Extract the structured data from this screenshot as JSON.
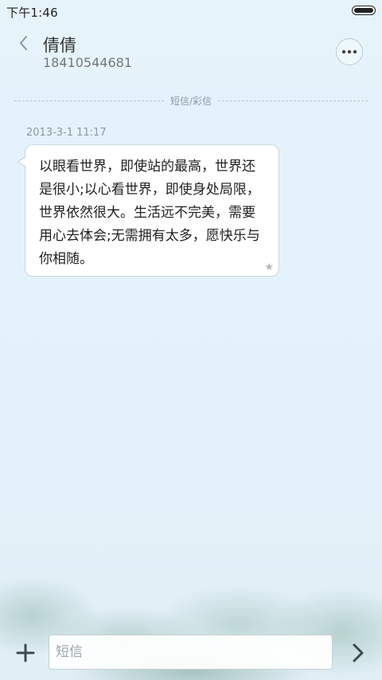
{
  "status_bar": {
    "time": "下午1:46",
    "battery_icon": "battery-icon"
  },
  "header": {
    "contact_name": "倩倩",
    "contact_number": "18410544681",
    "back_icon": "chevron-left-icon",
    "more_icon": "more-horizontal-icon"
  },
  "conversation": {
    "divider_label": "短信/彩信",
    "messages": [
      {
        "timestamp": "2013-3-1 11:17",
        "text": "以眼看世界，即使站的最高，世界还是很小;以心看世界，即使身处局限，世界依然很大。生活远不完美，需要用心去体会;无需拥有太多，愿快乐与你相随。",
        "starred_icon": "star-icon",
        "star_glyph": "★"
      }
    ]
  },
  "composer": {
    "placeholder": "短信",
    "value": "",
    "add_icon": "plus-icon",
    "send_icon": "chevron-right-icon"
  },
  "colors": {
    "background": "#e3f1fb",
    "bubble": "#ffffff",
    "accent_text": "#333333",
    "muted_text": "#8a9aa5"
  }
}
